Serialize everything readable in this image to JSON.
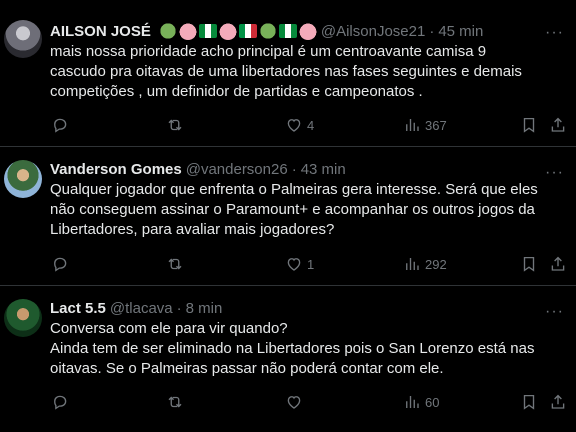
{
  "tweets": [
    {
      "name": "AILSON JOSÉ",
      "emojis": [
        "green-heart",
        "pig",
        "nigeria-flag",
        "pig",
        "italy-flag",
        "green-heart",
        "nigeria-flag",
        "pig"
      ],
      "handle": "@AilsonJose21",
      "separator": "·",
      "time": "45 min",
      "more": "···",
      "lines": [
        "mais nossa prioridade acho  principal  é  um centroavante  camisa  9",
        "cascudo pra  oitavas de uma libertadores  nas fases  seguintes  e  demais",
        "competições ,  um definidor de partidas e  campeonatos ."
      ],
      "reply_count": "",
      "repost_count": "",
      "like_count": "4",
      "view_count": "367"
    },
    {
      "name": "Vanderson Gomes",
      "emojis": [],
      "handle": "@vanderson26",
      "separator": "·",
      "time": "43 min",
      "more": "···",
      "lines": [
        "Qualquer jogador que enfrenta o Palmeiras gera interesse. Será que eles",
        "não conseguem assinar o Paramount+ e acompanhar os outros jogos da",
        "Libertadores, para avaliar mais jogadores?"
      ],
      "reply_count": "",
      "repost_count": "",
      "like_count": "1",
      "view_count": "292"
    },
    {
      "name": "Lact 5.5",
      "emojis": [],
      "handle": "@tlacava",
      "separator": "·",
      "time": "8 min",
      "more": "···",
      "lines": [
        "Conversa com ele para vir quando?",
        "Ainda tem de ser eliminado na Libertadores pois o San Lorenzo está nas",
        "oitavas. Se o Palmeiras passar não poderá contar com ele."
      ],
      "reply_count": "",
      "repost_count": "",
      "like_count": "",
      "view_count": "60"
    }
  ]
}
